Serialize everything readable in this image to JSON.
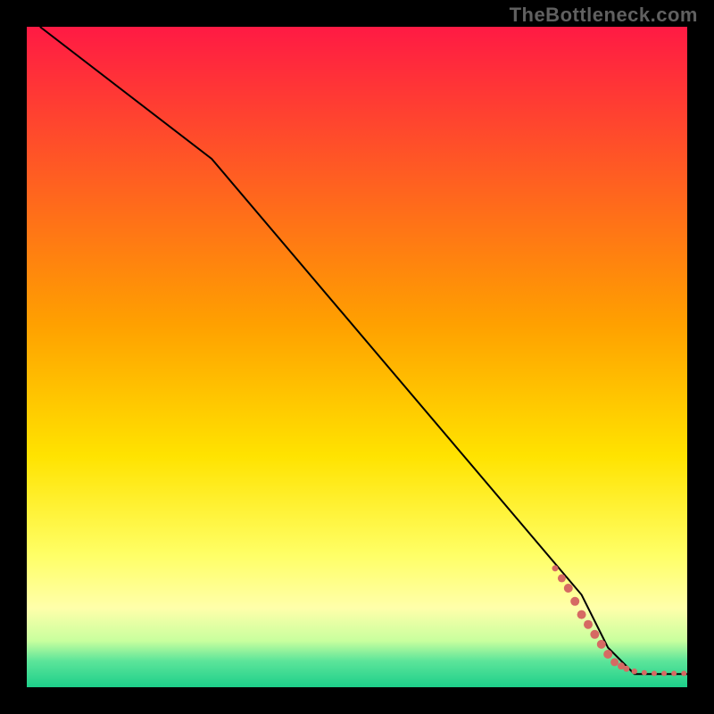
{
  "watermark": "TheBottleneck.com",
  "chart_data": {
    "type": "line",
    "title": "",
    "xlabel": "",
    "ylabel": "",
    "xlim": [
      0,
      100
    ],
    "ylim": [
      0,
      100
    ],
    "gradient_stops": [
      {
        "offset": 0.0,
        "color": "#ff1a44"
      },
      {
        "offset": 0.45,
        "color": "#ffa000"
      },
      {
        "offset": 0.65,
        "color": "#ffe300"
      },
      {
        "offset": 0.8,
        "color": "#ffff66"
      },
      {
        "offset": 0.88,
        "color": "#ffffaa"
      },
      {
        "offset": 0.93,
        "color": "#c8ff9e"
      },
      {
        "offset": 0.96,
        "color": "#5de59a"
      },
      {
        "offset": 1.0,
        "color": "#1dcf8a"
      }
    ],
    "series": [
      {
        "name": "curve",
        "type": "line",
        "points": [
          {
            "x": 2,
            "y": 100
          },
          {
            "x": 28,
            "y": 80
          },
          {
            "x": 84,
            "y": 14
          },
          {
            "x": 88,
            "y": 6
          },
          {
            "x": 92,
            "y": 2
          },
          {
            "x": 100,
            "y": 2
          }
        ]
      },
      {
        "name": "highlighted-points",
        "type": "scatter",
        "color": "#d66a63",
        "points": [
          {
            "x": 80,
            "y": 18,
            "r": 3.5
          },
          {
            "x": 81,
            "y": 16.5,
            "r": 4.5
          },
          {
            "x": 82,
            "y": 15,
            "r": 5
          },
          {
            "x": 83,
            "y": 13,
            "r": 5
          },
          {
            "x": 84,
            "y": 11,
            "r": 5
          },
          {
            "x": 85,
            "y": 9.5,
            "r": 5
          },
          {
            "x": 86,
            "y": 8,
            "r": 5
          },
          {
            "x": 87,
            "y": 6.5,
            "r": 5
          },
          {
            "x": 88,
            "y": 5,
            "r": 5
          },
          {
            "x": 89,
            "y": 3.8,
            "r": 4.5
          },
          {
            "x": 90,
            "y": 3.2,
            "r": 4
          },
          {
            "x": 90.8,
            "y": 2.8,
            "r": 3.5
          },
          {
            "x": 92,
            "y": 2.4,
            "r": 3.2
          },
          {
            "x": 93.5,
            "y": 2.2,
            "r": 3
          },
          {
            "x": 95,
            "y": 2.1,
            "r": 3
          },
          {
            "x": 96.5,
            "y": 2.1,
            "r": 3
          },
          {
            "x": 98,
            "y": 2.1,
            "r": 3
          },
          {
            "x": 99.5,
            "y": 2.1,
            "r": 3
          }
        ]
      }
    ]
  }
}
